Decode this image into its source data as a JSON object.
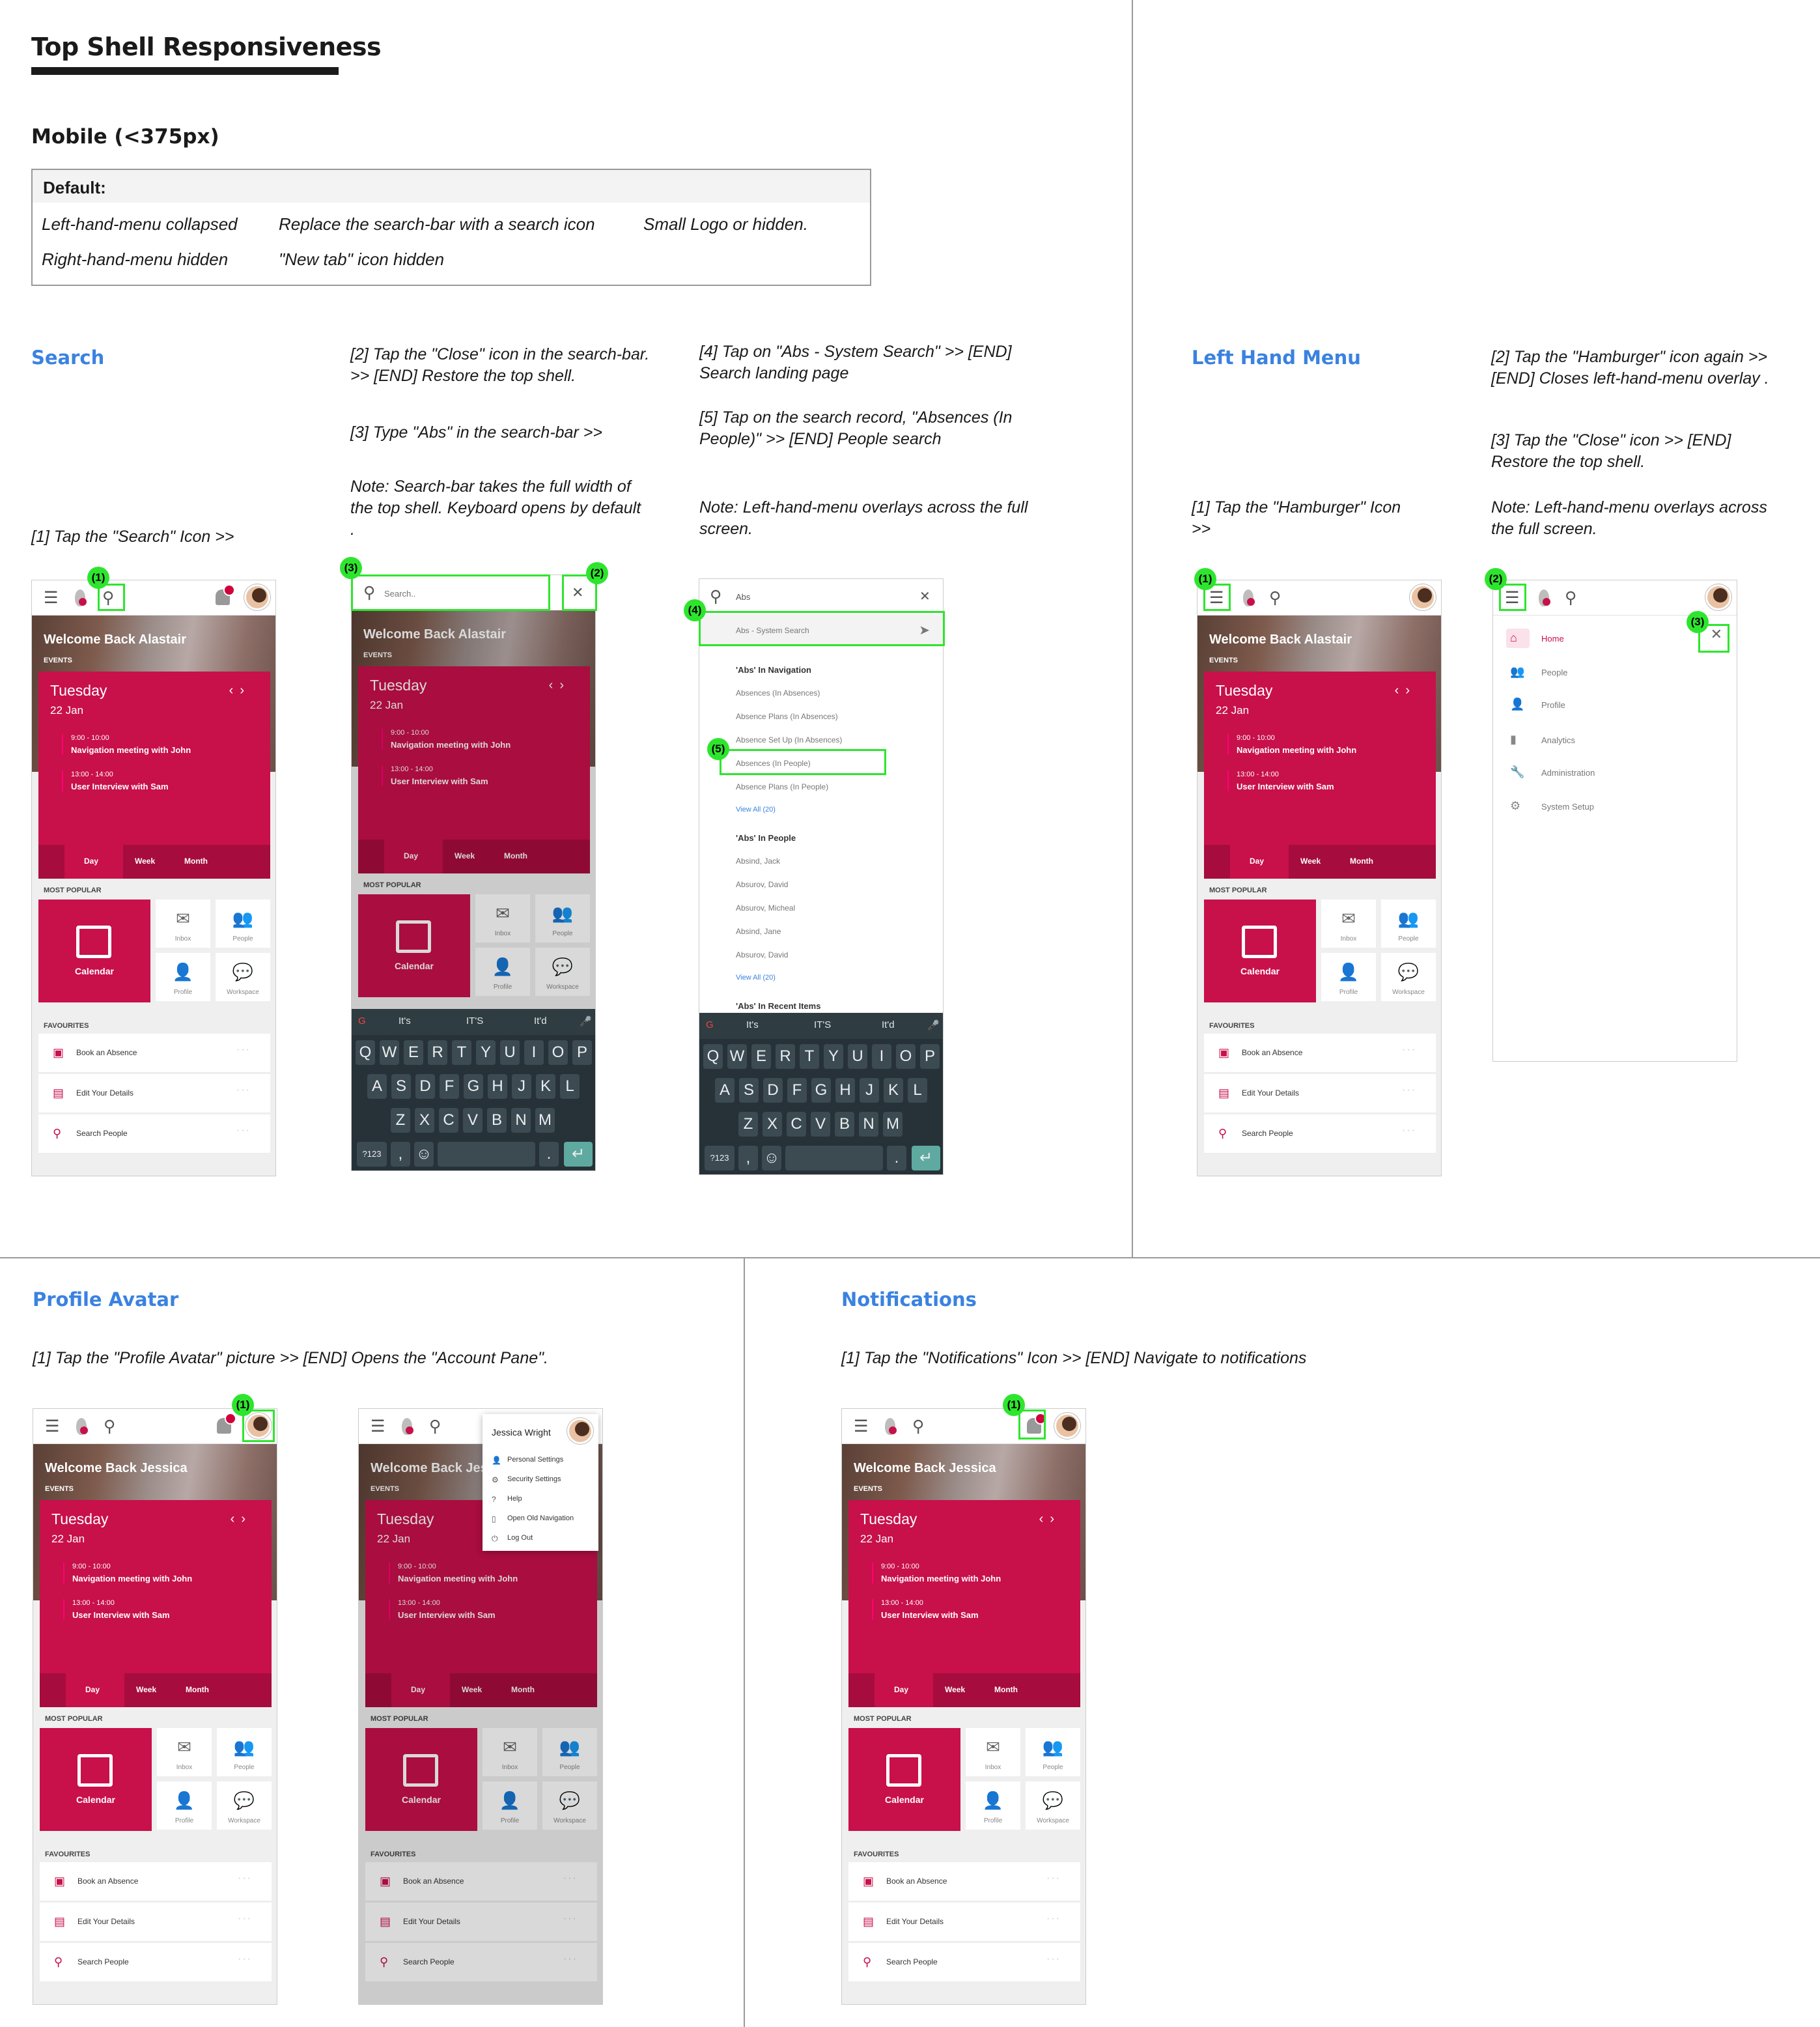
{
  "page": {
    "title": "Top Shell Responsiveness",
    "subtitle": "Mobile (<375px)"
  },
  "defaults": {
    "heading": "Default:",
    "items": [
      "Left-hand-menu collapsed",
      "Replace the search-bar with a search icon",
      "Small Logo or hidden.",
      "Right-hand-menu hidden",
      "\"New tab\" icon hidden"
    ]
  },
  "sections": {
    "search": "Search",
    "lhm": "Left Hand Menu",
    "profile": "Profile Avatar",
    "notifications": "Notifications"
  },
  "notes": {
    "search_1": "[1] Tap the \"Search\" Icon >>",
    "search_2": "[2] Tap the \"Close\" icon in the search-bar.  >> [END] Restore the top shell.",
    "search_3": "[3] Type \"Abs\" in the search-bar >>",
    "search_note": "Note: Search-bar takes the full width of the top shell. Keyboard opens by default .",
    "search_4": "[4] Tap on \"Abs - System Search\" >> [END] Search landing page",
    "search_5": "[5] Tap on the search record, \"Absences (In People)\"  >> [END] People search",
    "search_note2": "Note: Left-hand-menu overlays across the full screen.",
    "lhm_1": "[1] Tap the \"Hamburger\" Icon >>",
    "lhm_2": "[2] Tap the \"Hamburger\" icon again >> [END] Closes left-hand-menu overlay .",
    "lhm_3": "[3] Tap the \"Close\" icon  >> [END] Restore the top shell.",
    "lhm_note": "Note: Left-hand-menu overlays across the full screen.",
    "profile_1": "[1] Tap the \"Profile Avatar\" picture >> [END] Opens the \"Account Pane\".",
    "notif_1": "[1] Tap the \"Notifications\" Icon >> [END] Navigate to notifications"
  },
  "phone": {
    "welcome_alastair": "Welcome Back Alastair",
    "welcome_jessica": "Welcome Back Jessica",
    "events": "EVENTS",
    "day": "Tuesday",
    "date": "22 Jan",
    "event1_time": "9:00 - 10:00",
    "event1_name": "Navigation meeting with John",
    "event2_time": "13:00 - 14:00",
    "event2_name": "User Interview with Sam",
    "tab_day": "Day",
    "tab_week": "Week",
    "tab_month": "Month",
    "most_popular": "MOST POPULAR",
    "calendar": "Calendar",
    "inbox": "Inbox",
    "people": "People",
    "profile": "Profile",
    "workspace": "Workspace",
    "favourites": "FAVOURITES",
    "fav1": "Book an Absence",
    "fav2": "Edit Your Details",
    "fav3": "Search People"
  },
  "search": {
    "placeholder": "Search..",
    "typed": "Abs",
    "system_search": "Abs - System Search",
    "nav_heading": "'Abs' In Navigation",
    "nav_results": [
      "Absences (In Absences)",
      "Absence Plans (In Absences)",
      "Absence Set Up (In Absences)",
      "Absences (In People)",
      "Absence Plans (In People)"
    ],
    "view_all_nav": "View All (20)",
    "people_heading": "'Abs' In People",
    "people_results": [
      "Absind, Jack",
      "Absurov, David",
      "Absurov, Micheal",
      "Absind, Jane",
      "Absurov, David"
    ],
    "view_all_people": "View All (20)",
    "recent_heading": "'Abs' In Recent Items"
  },
  "keyboard": {
    "suggestions": [
      "It's",
      "IT'S",
      "It'd"
    ],
    "row1": [
      "Q",
      "W",
      "E",
      "R",
      "T",
      "Y",
      "U",
      "I",
      "O",
      "P"
    ],
    "row2": [
      "A",
      "S",
      "D",
      "F",
      "G",
      "H",
      "J",
      "K",
      "L"
    ],
    "row3": [
      "Z",
      "X",
      "C",
      "V",
      "B",
      "N",
      "M"
    ],
    "numbers": "?123",
    "comma": ",",
    "period": "."
  },
  "lhm": {
    "items": [
      "Home",
      "People",
      "Profile",
      "Analytics",
      "Administration",
      "System Setup"
    ]
  },
  "account": {
    "name": "Jessica Wright",
    "items": [
      "Personal Settings",
      "Security Settings",
      "Help",
      "Open Old Navigation",
      "Log Out"
    ]
  },
  "badges": [
    "(1)",
    "(2)",
    "(3)",
    "(4)",
    "(5)"
  ],
  "colors": {
    "accent": "#c8104b",
    "link": "#3a82e0",
    "highlight": "#2ee52e"
  }
}
